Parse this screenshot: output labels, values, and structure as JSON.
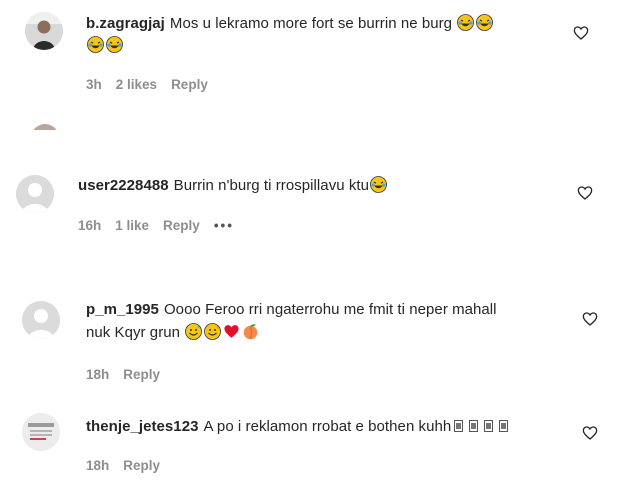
{
  "comments": [
    {
      "username": "b.zagragjaj",
      "text": "Mos u lekramo more fort se burrin ne burg",
      "time": "3h",
      "likes": "2 likes",
      "reply": "Reply",
      "emoji": [
        "laughing-tears-emoji",
        "laughing-tears-emoji",
        "laughing-tears-emoji",
        "laughing-tears-emoji"
      ]
    },
    {
      "username": "user2228488",
      "text": "Burrin n'burg ti rrospillavu ktu",
      "time": "16h",
      "likes": "1 like",
      "reply": "Reply",
      "more": "•••",
      "emoji": [
        "laughing-tears-emoji"
      ]
    },
    {
      "username": "p_m_1995",
      "text": "Oooo Feroo rri ngaterrohu me fmit ti neper mahall",
      "text_line2": "nuk Kqyr grun",
      "time": "18h",
      "reply": "Reply",
      "emoji": [
        "grinning-sweat-emoji",
        "grinning-sweat-emoji",
        "red-heart-emoji",
        "peach-emoji"
      ]
    },
    {
      "username": "thenje_jetes123",
      "text": "A po i reklamon rrobat e bothen kuhh",
      "time": "18h",
      "reply": "Reply",
      "emoji": [
        "missing-glyph",
        "missing-glyph",
        "missing-glyph",
        "missing-glyph"
      ]
    }
  ]
}
